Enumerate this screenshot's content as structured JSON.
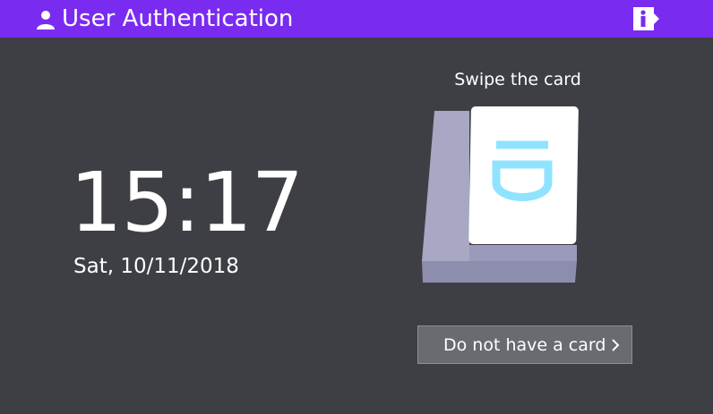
{
  "header": {
    "title": "User Authentication",
    "icons": {
      "user": "user-icon",
      "info": "info-icon"
    }
  },
  "clock": {
    "time": "15:17",
    "date": "Sat, 10/11/2018"
  },
  "card_panel": {
    "instruction": "Swipe the card",
    "card_icon": "id-card-reader-icon",
    "card_text": "ID"
  },
  "actions": {
    "no_card_label": "Do not have a card",
    "no_card_icon": "chevron-right-icon"
  },
  "colors": {
    "header_bg": "#7a2bf0",
    "background": "#3e3f44",
    "button_bg": "#6a6b71",
    "id_text": "#8fe3ff"
  }
}
